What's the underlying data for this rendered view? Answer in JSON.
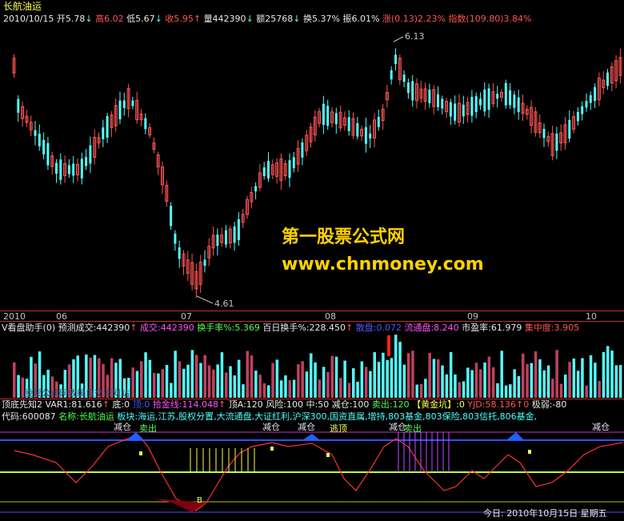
{
  "stock": {
    "name": "长航油运",
    "date": "2010/10/15",
    "open_label": "开5.78",
    "open_arrow": "↓",
    "high_label": "高6.02",
    "low_label": "低5.67",
    "low_arrow": "↓",
    "close_label": "收5.95",
    "close_arrow": "↑",
    "volume_label": "量442390",
    "volume_arrow": "↓",
    "amount_label": "额25768",
    "amount_arrow": "↓",
    "turnover_label": "换5.37%",
    "amplitude_label": "振6.01%",
    "change_label": "涨(0.13)2.23%",
    "index_label": "指数(109.80)3.84%"
  },
  "price_chart": {
    "high_marker": "6.13",
    "low_marker": "4.61",
    "x_labels": [
      "2010",
      "06",
      "07",
      "08",
      "09",
      "10"
    ]
  },
  "watermark": {
    "line1": "第一股票公式网",
    "line2": "www.chnmoney.com"
  },
  "volume_panel": {
    "title": "V看盘助手(0)",
    "forecast": "预测成交:442390",
    "forecast_arrow": "↑",
    "deal": "成交:442390",
    "turnover": "换手率%:5.369",
    "hundred_day": "百日换手%:228.450",
    "up_marker": "↑",
    "big": "散盘:0.072",
    "float": "流通盘:8.240",
    "pe": "市盈率:61.979",
    "concentration": "集中度:3.905",
    "faded_text": "股票公式网收编自交流网站"
  },
  "indicator": {
    "title": "顶底先知2",
    "var1": "VAR1:81.616",
    "var1_arrow": "↑",
    "bottom": "底:0",
    "top": "顶:0",
    "gold_line": "拾金线:114.048",
    "gold_arrow": "↑",
    "top_a": "顶A:120",
    "risk": "风险:100",
    "mid": "中:50",
    "reduce": "减仓:100",
    "sell": "卖出:120",
    "gold_pit": "【黄金坑】:0",
    "yjd": "YJD:58.136",
    "yjd_arrow": "↑0",
    "extreme": "极弱:-80",
    "code": "代码:600087",
    "name_label": "名称:长航油运",
    "sector": "板块:海运,江苏,股权分置,大流通盘,大证红利,沪深300,国资直属,增持,803基金,803保险,803信托,806基金,",
    "signal_reduce": "减仓",
    "signal_sell": "卖出",
    "signal_top": "逃顶",
    "b_marker": "B",
    "today": "今日:  2010年10月15日  星期五"
  },
  "colors": {
    "up": "#ff5454",
    "down": "#54fcfc",
    "bg": "#000000",
    "watermark": "#ffd200"
  }
}
